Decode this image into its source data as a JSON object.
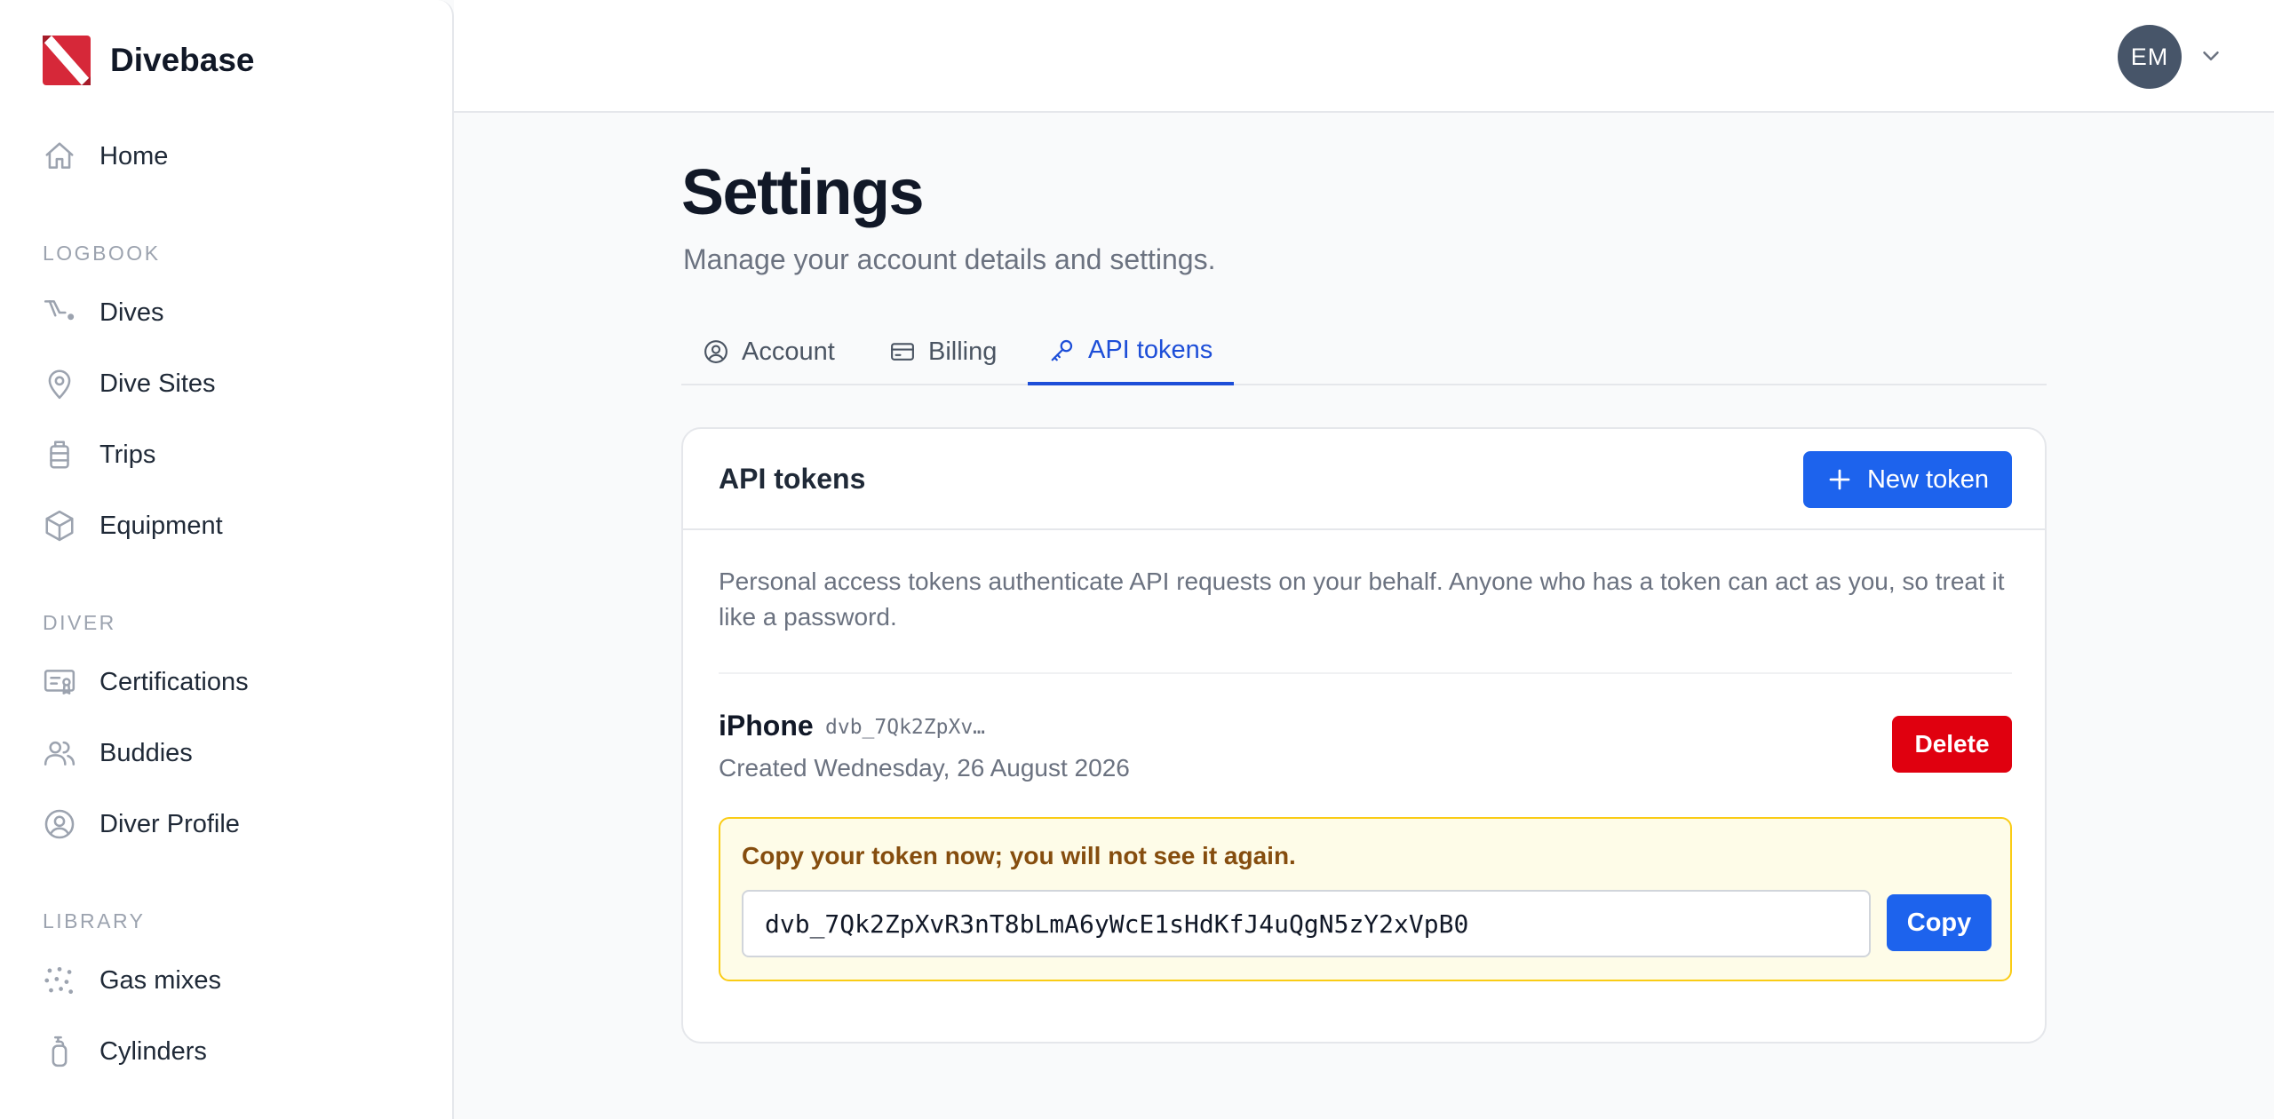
{
  "brand": {
    "name": "Divebase",
    "logo_icon": "dive-flag-logo",
    "logo_color": "#d62839"
  },
  "nav": {
    "home": {
      "label": "Home",
      "icon": "home-icon"
    },
    "sections": [
      {
        "label": "LOGBOOK",
        "items": [
          {
            "label": "Dives",
            "icon": "dive-path-icon"
          },
          {
            "label": "Dive Sites",
            "icon": "map-pin-icon"
          },
          {
            "label": "Trips",
            "icon": "luggage-icon"
          },
          {
            "label": "Equipment",
            "icon": "cube-icon"
          }
        ]
      },
      {
        "label": "DIVER",
        "items": [
          {
            "label": "Certifications",
            "icon": "certificate-icon"
          },
          {
            "label": "Buddies",
            "icon": "users-icon"
          },
          {
            "label": "Diver Profile",
            "icon": "user-circle-icon"
          }
        ]
      },
      {
        "label": "LIBRARY",
        "items": [
          {
            "label": "Gas mixes",
            "icon": "dots-grid-icon"
          },
          {
            "label": "Cylinders",
            "icon": "cylinder-icon"
          }
        ]
      }
    ]
  },
  "user": {
    "initials": "EM"
  },
  "page": {
    "title": "Settings",
    "subtitle": "Manage your account details and settings."
  },
  "tabs": [
    {
      "label": "Account",
      "icon": "user-circle-icon",
      "active": false
    },
    {
      "label": "Billing",
      "icon": "credit-card-icon",
      "active": false
    },
    {
      "label": "API tokens",
      "icon": "key-icon",
      "active": true
    }
  ],
  "card": {
    "title": "API tokens",
    "new_token_label": "New token",
    "description": "Personal access tokens authenticate API requests on your behalf. Anyone who has a token can act as you, so treat it like a password.",
    "token": {
      "name": "iPhone",
      "prefix": "dvb_7Qk2ZpXv…",
      "created": "Created Wednesday, 26 August 2026",
      "delete_label": "Delete",
      "notice": "Copy your token now; you will not see it again.",
      "value": "dvb_7Qk2ZpXvR3nT8bLmA6yWcE1sHdKfJ4uQgN5zY2xVpB0",
      "copy_label": "Copy"
    }
  },
  "colors": {
    "accent": "#1d63ed",
    "active_tab": "#1d4ed8",
    "danger": "#e0000f",
    "notice_bg": "#fefce8",
    "notice_border": "#facc15",
    "avatar_bg": "#475569"
  }
}
